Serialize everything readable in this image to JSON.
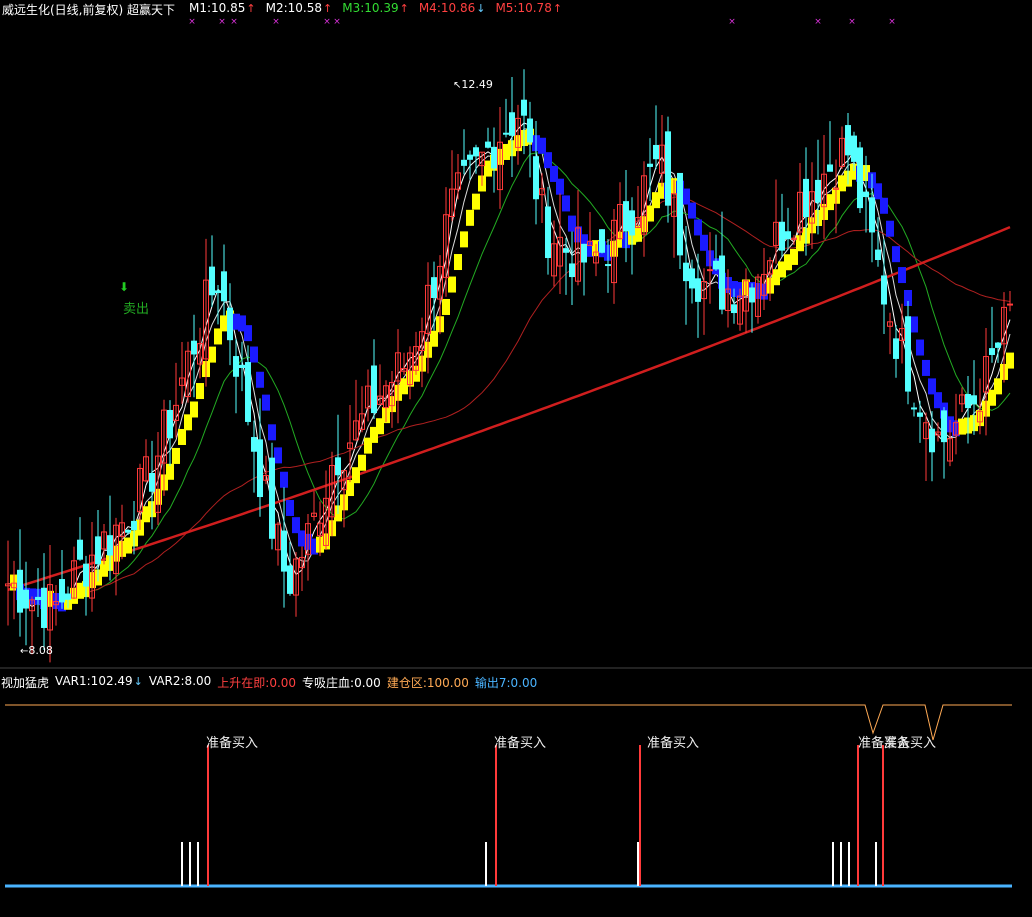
{
  "header": {
    "title": "威远生化(日线,前复权) 超赢天下",
    "ma": [
      {
        "label": "M1:10.85",
        "arrow": "↑",
        "color": "#ffffff",
        "arrow_color": "#ff4040"
      },
      {
        "label": "M2:10.58",
        "arrow": "↑",
        "color": "#ffffff",
        "arrow_color": "#ff4040"
      },
      {
        "label": "M3:10.39",
        "arrow": "↑",
        "color": "#33dd33",
        "arrow_color": "#ff4040"
      },
      {
        "label": "M4:10.86",
        "arrow": "↓",
        "color": "#ff4040",
        "arrow_color": "#66ccff"
      },
      {
        "label": "M5:10.78",
        "arrow": "↑",
        "color": "#ff4040",
        "arrow_color": "#ff4040"
      }
    ]
  },
  "chart": {
    "high_label": "12.49",
    "low_label": "8.08",
    "sell_label": "卖出"
  },
  "indicator": {
    "title": "视加猛虎",
    "var1": "VAR1:102.49",
    "var1_arrow": "↓",
    "var2": "VAR2:8.00",
    "up_soon": "上升在即:0.00",
    "absorb": "专吸庄血:0.00",
    "build_zone": "建仓区:100.00",
    "output": "输出7:0.00",
    "signals": [
      "准备买入",
      "准备买入",
      "准备买入",
      "准备买入",
      "准备买入"
    ]
  },
  "colors": {
    "up": "#ff3a3a",
    "down": "#54ffff",
    "yellow_band": "#ffff00",
    "blue_band": "#1a1aff",
    "ma_long": "#d01e1e",
    "ma_mid": "#b02020",
    "ma_green": "#22aa22",
    "indicator_line": "#ffaa55",
    "base_line": "#4ab4ff"
  },
  "chart_data": {
    "type": "candlestick",
    "title": "威远生化(日线,前复权)",
    "price_high": 12.49,
    "price_low": 8.08,
    "moving_averages": {
      "M1": 10.85,
      "M2": 10.58,
      "M3": 10.39,
      "M4": 10.86,
      "M5": 10.78
    },
    "close_anchor": [
      8.6,
      8.5,
      8.4,
      8.7,
      8.9,
      9.1,
      9.4,
      9.9,
      10.5,
      11.0,
      10.2,
      9.3,
      8.6,
      9.0,
      9.6,
      9.8,
      10.1,
      10.3,
      10.8,
      11.5,
      11.8,
      12.1,
      12.3,
      11.4,
      11.2,
      11.1,
      11.3,
      11.6,
      11.9,
      11.2,
      10.9,
      10.9,
      11.0,
      11.3,
      11.6,
      11.8,
      12.0,
      11.3,
      10.6,
      10.1,
      9.7,
      9.9,
      10.2,
      10.7
    ]
  }
}
